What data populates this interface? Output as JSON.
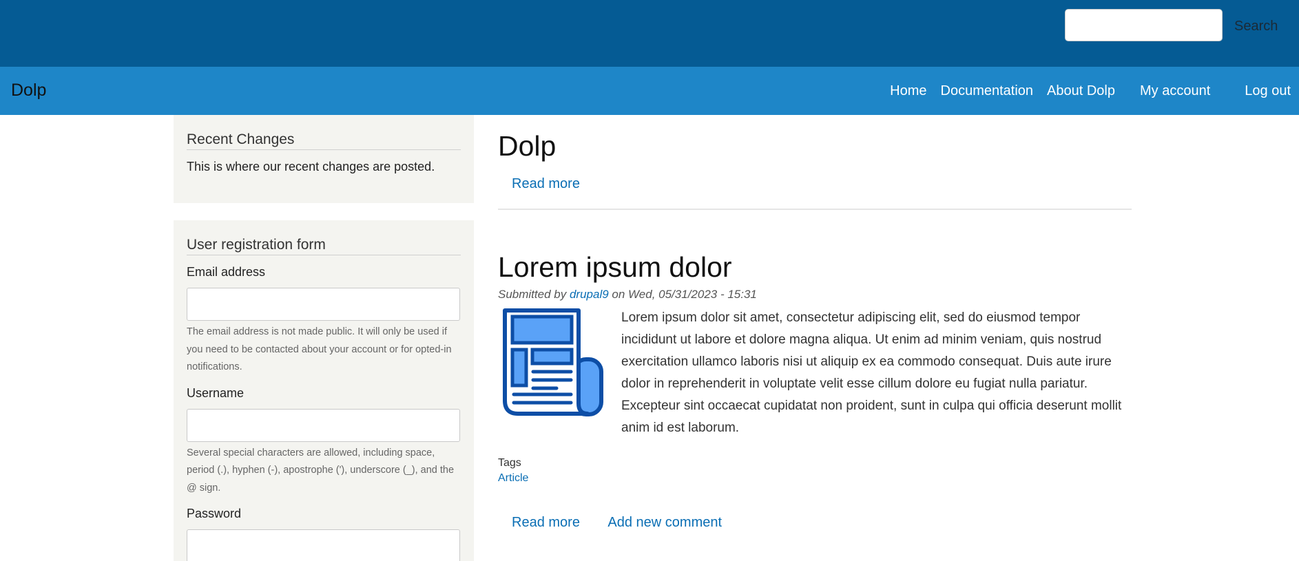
{
  "header": {
    "search_placeholder": "",
    "search_button": "Search"
  },
  "nav": {
    "site_name": "Dolp",
    "links": [
      "Home",
      "Documentation",
      "About Dolp",
      "My account",
      "Log out"
    ]
  },
  "sidebar": {
    "recent_changes": {
      "title": "Recent Changes",
      "text": "This is where our recent changes are posted."
    },
    "registration": {
      "title": "User registration form",
      "email_label": "Email address",
      "email_value": "",
      "email_description": "The email address is not made public. It will only be used if you need to be contacted about your account or for opted-in notifications.",
      "username_label": "Username",
      "username_value": "",
      "username_description": "Several special characters are allowed, including space, period (.), hyphen (-), apostrophe ('), underscore (_), and the @ sign.",
      "password_label": "Password",
      "password_value": ""
    }
  },
  "main": {
    "page_title": "Dolp",
    "read_more": "Read more",
    "article": {
      "title": "Lorem ipsum dolor",
      "submitted_prefix": "Submitted by",
      "author": "drupal9",
      "submitted_suffix": "on Wed, 05/31/2023 - 15:31",
      "image_icon": "newspaper-icon",
      "body": "Lorem ipsum dolor sit amet, consectetur adipiscing elit, sed do eiusmod tempor incididunt ut labore et dolore magna aliqua. Ut enim ad minim veniam, quis nostrud exercitation ullamco laboris nisi ut aliquip ex ea commodo consequat. Duis aute irure dolor in reprehenderit in voluptate velit esse cillum dolore eu fugiat nulla pariatur. Excepteur sint occaecat cupidatat non proident, sunt in culpa qui officia deserunt mollit anim id est laborum.",
      "tags_label": "Tags",
      "tag": "Article",
      "read_more": "Read more",
      "add_comment": "Add new comment"
    }
  },
  "colors": {
    "top_bar": "#055b94",
    "nav_bar": "#1e86c8",
    "link": "#0a6eb4",
    "sidebar_bg": "#f4f4f0"
  }
}
